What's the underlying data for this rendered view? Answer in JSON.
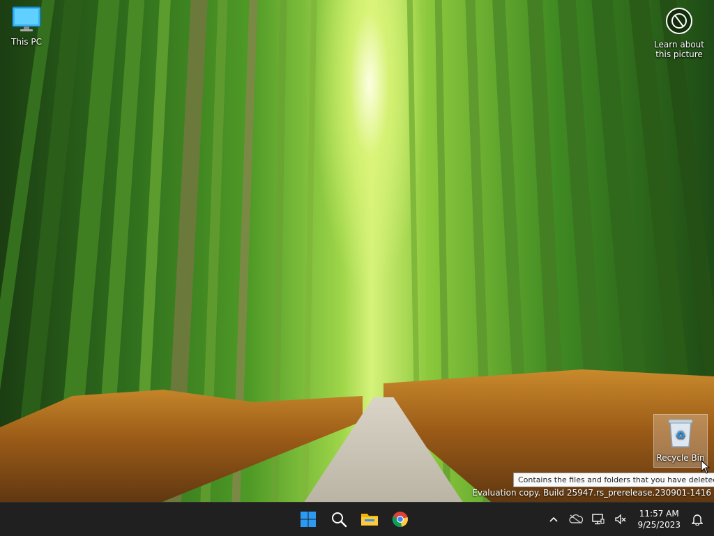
{
  "desktop": {
    "this_pc_label": "This PC",
    "learn_label_1": "Learn about",
    "learn_label_2": "this picture",
    "recycle_bin_label": "Recycle Bin",
    "tooltip": "Contains the files and folders that you have deleted.",
    "watermark": "Evaluation copy. Build 25947.rs_prerelease.230901-1416"
  },
  "taskbar": {
    "apps": [
      "windows-start",
      "search",
      "file-explorer",
      "chrome"
    ],
    "time": "11:57 AM",
    "date": "9/25/2023"
  },
  "colors": {
    "taskbar_bg": "#202020",
    "windows_blue": "#2b9af3"
  }
}
